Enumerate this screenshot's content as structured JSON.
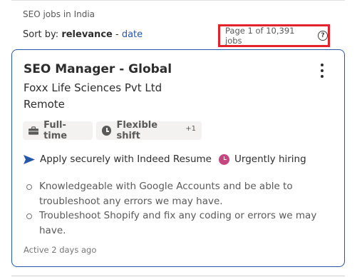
{
  "header": {
    "query_caption": "SEO jobs in India",
    "sort_prefix": "Sort by:",
    "sort_active": "relevance",
    "sort_separator": "-",
    "sort_alt": "date",
    "page_count": "Page 1 of 10,391 jobs",
    "help_icon": "?"
  },
  "job": {
    "title": "SEO Manager - Global",
    "company": "Foxx Life Sciences Pvt Ltd",
    "location": "Remote",
    "tags": [
      {
        "label": "Full-time",
        "icon": "briefcase-icon"
      },
      {
        "label": "Flexible shift",
        "icon": "clock-icon",
        "more": "+1"
      }
    ],
    "apply_text": "Apply securely with Indeed Resume",
    "urgent_text": "Urgently hiring",
    "snippet": [
      "Knowledgeable with Google Accounts and be able to troubleshoot any errors we may have.",
      "Troubleshoot Shopify and fix any coding or errors we may have."
    ],
    "posted": "Active 2 days ago"
  },
  "colors": {
    "card_border": "#2557a7",
    "link": "#2557a7",
    "highlight_box": "#e3232b",
    "urgent": "#c6477f"
  }
}
